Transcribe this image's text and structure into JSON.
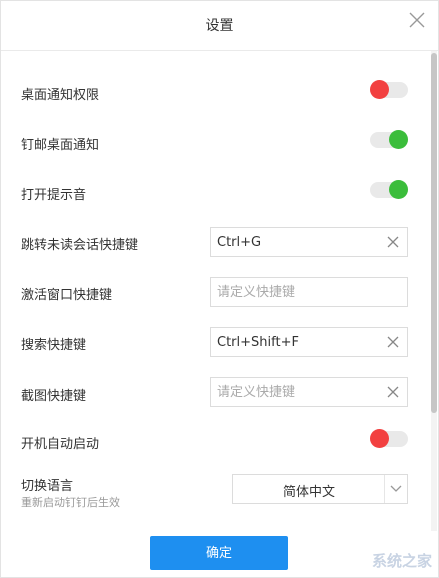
{
  "dialog": {
    "title": "设置"
  },
  "settings": {
    "desktop_notify": {
      "label": "桌面通知权限",
      "enabled": false
    },
    "dingmail_notify": {
      "label": "钉邮桌面通知",
      "enabled": true
    },
    "sound": {
      "label": "打开提示音",
      "enabled": true
    },
    "jump_unread": {
      "label": "跳转未读会话快捷键",
      "value": "Ctrl+G",
      "placeholder": "请定义快捷键"
    },
    "activate_window": {
      "label": "激活窗口快捷键",
      "value": "",
      "placeholder": "请定义快捷键"
    },
    "search": {
      "label": "搜索快捷键",
      "value": "Ctrl+Shift+F",
      "placeholder": "请定义快捷键"
    },
    "screenshot": {
      "label": "截图快捷键",
      "value": "",
      "placeholder": "请定义快捷键"
    },
    "autostart": {
      "label": "开机自动启动",
      "enabled": false
    },
    "language": {
      "label": "切换语言",
      "note": "重新启动钉钉后生效",
      "selected": "简体中文"
    }
  },
  "footer": {
    "confirm_label": "确定"
  },
  "watermark": {
    "text": "系统之家"
  },
  "colors": {
    "toggle_on": "#3bbd3b",
    "toggle_off": "#f24040",
    "primary": "#1e8ff0"
  },
  "icons": {
    "close": "close-icon",
    "clear": "clear-icon",
    "dropdown": "chevron-down-icon"
  }
}
